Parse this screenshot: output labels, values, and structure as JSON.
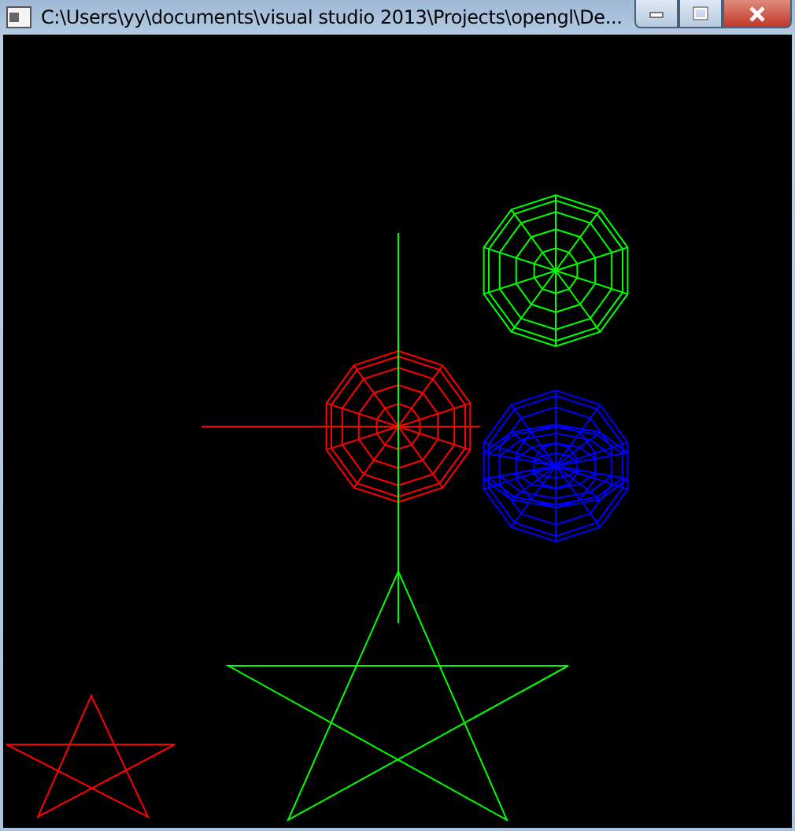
{
  "window": {
    "title": "C:\\Users\\yy\\documents\\visual studio 2013\\Projects\\opengl\\De..."
  }
}
